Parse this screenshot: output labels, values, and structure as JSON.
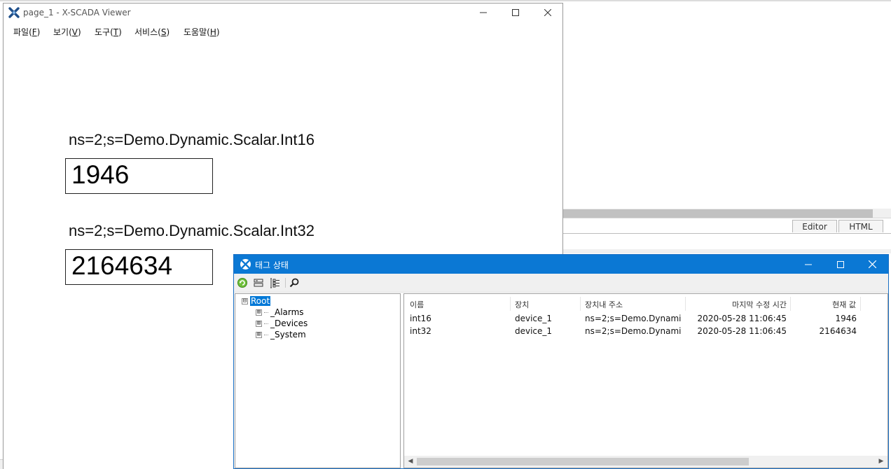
{
  "viewer": {
    "title": "page_1 - X-SCADA Viewer",
    "menu": [
      {
        "label": "파일(",
        "acc": "F",
        "tail": ")"
      },
      {
        "label": "보기(",
        "acc": "V",
        "tail": ")"
      },
      {
        "label": "도구(",
        "acc": "T",
        "tail": ")"
      },
      {
        "label": "서비스(",
        "acc": "S",
        "tail": ")"
      },
      {
        "label": "도움말(",
        "acc": "H",
        "tail": ")"
      }
    ],
    "tags": [
      {
        "label": "ns=2;s=Demo.Dynamic.Scalar.Int16",
        "value": "1946"
      },
      {
        "label": "ns=2;s=Demo.Dynamic.Scalar.Int32",
        "value": "2164634"
      }
    ]
  },
  "background": {
    "tabs": [
      "Editor",
      "HTML"
    ]
  },
  "tag_window": {
    "title": "태그 상태",
    "toolbar_icons": [
      "refresh-icon",
      "collapse-icon",
      "expand-tree-icon",
      "search-icon"
    ],
    "tree": [
      {
        "label": "Root",
        "expander": "⊟",
        "selected": true
      },
      {
        "label": "_Alarms",
        "expander": "⊞",
        "selected": false
      },
      {
        "label": "_Devices",
        "expander": "⊞",
        "selected": false
      },
      {
        "label": "_System",
        "expander": "⊞",
        "selected": false
      }
    ],
    "columns": [
      "이름",
      "장치",
      "장치내 주소",
      "마지막 수정 시간",
      "현재 값"
    ],
    "rows": [
      [
        "int16",
        "device_1",
        "ns=2;s=Demo.Dynami...",
        "2020-05-28 11:06:45",
        "1946"
      ],
      [
        "int32",
        "device_1",
        "ns=2;s=Demo.Dynami...",
        "2020-05-28 11:06:45",
        "2164634"
      ]
    ]
  }
}
